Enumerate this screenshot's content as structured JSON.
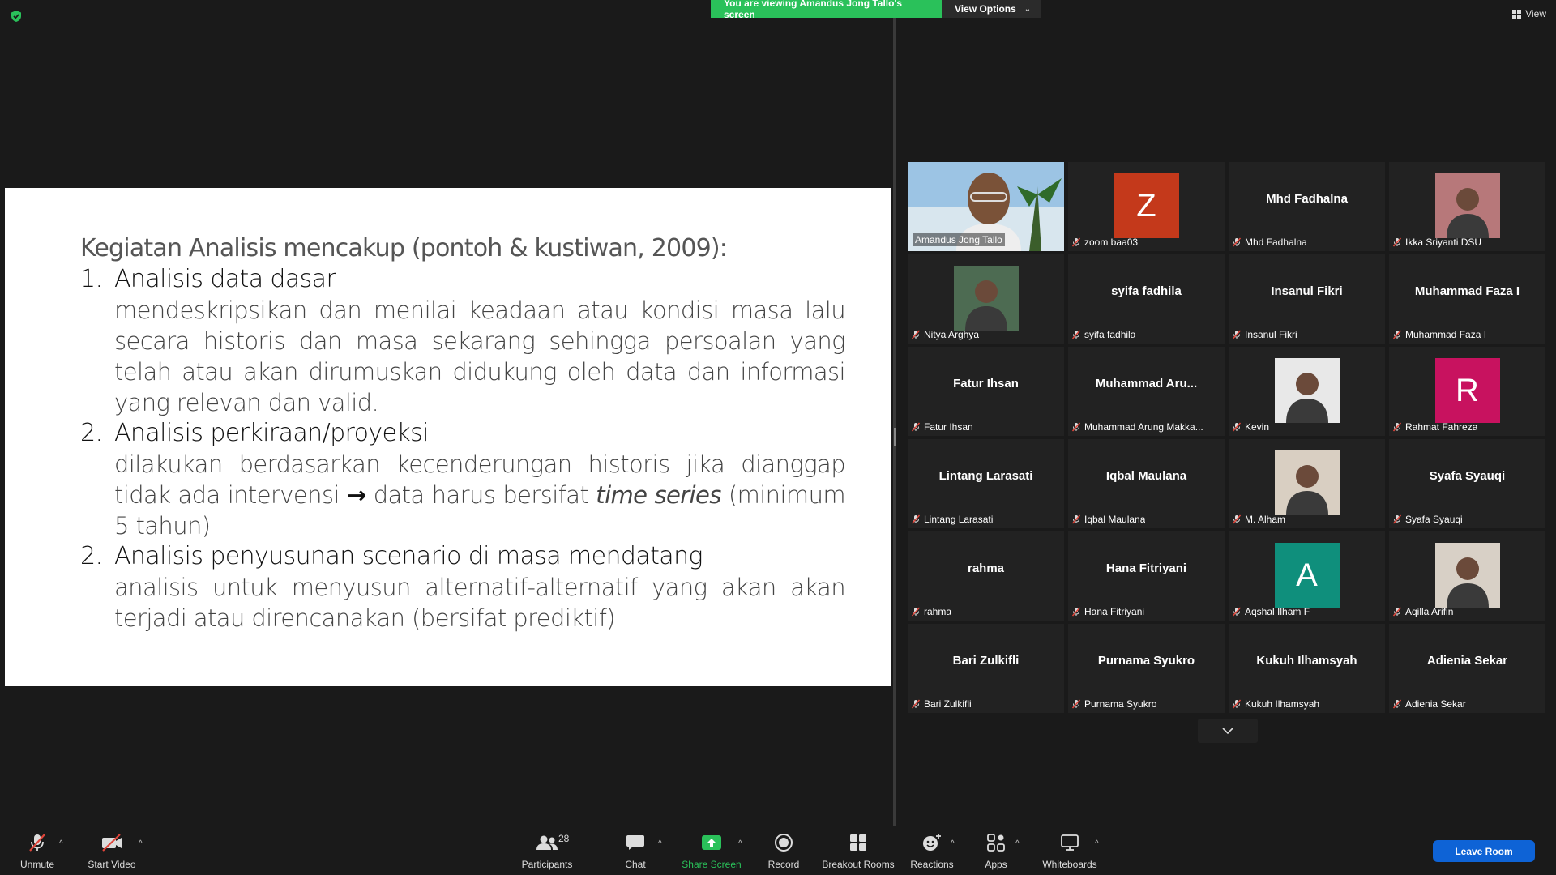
{
  "top": {
    "viewing_banner": "You are viewing Amandus Jong Tallo's screen",
    "view_options": "View Options",
    "view_button": "View"
  },
  "slide": {
    "heading": "Kegiatan Analisis mencakup (pontoh & kustiwan, 2009):",
    "items": [
      {
        "number": "1.",
        "title": "Analisis data dasar",
        "body": "mendeskripsikan dan menilai keadaan atau kondisi masa lalu secara historis dan masa sekarang sehingga persoalan yang telah atau akan  dirumuskan didukung oleh data dan informasi yang relevan dan valid."
      },
      {
        "number": "2.",
        "title": "Analisis perkiraan/proyeksi",
        "body_part1": "dilakukan berdasarkan kecenderungan historis jika dianggap tidak ada intervensi",
        "arrow": "→",
        "body_part2": "data harus bersifat",
        "body_italic": "time series",
        "body_part3": "(minimum 5 tahun)"
      },
      {
        "number": "2.",
        "title": "Analisis penyusunan scenario di masa mendatang",
        "body": "analisis untuk menyusun alternatif-alternatif yang akan akan terjadi atau direncanakan (bersifat prediktif)"
      }
    ]
  },
  "gallery": {
    "tiles": [
      {
        "label": "Amandus Jong Tallo",
        "display": "",
        "kind": "video",
        "active": true
      },
      {
        "label": "zoom baa03",
        "display": "Z",
        "kind": "avatar",
        "color": "#c4391b"
      },
      {
        "label": "Mhd Fadhalna",
        "display": "Mhd Fadhalna",
        "kind": "name"
      },
      {
        "label": "Ikka Sriyanti DSU",
        "display": "",
        "kind": "photo",
        "color": "#b7787a"
      },
      {
        "label": "Nitya Arghya",
        "display": "",
        "kind": "photo",
        "color": "#4d6b52"
      },
      {
        "label": "syifa fadhila",
        "display": "syifa fadhila",
        "kind": "name"
      },
      {
        "label": "Insanul Fikri",
        "display": "Insanul Fikri",
        "kind": "name"
      },
      {
        "label": "Muhammad Faza I",
        "display": "Muhammad Faza I",
        "kind": "name"
      },
      {
        "label": "Fatur Ihsan",
        "display": "Fatur Ihsan",
        "kind": "name"
      },
      {
        "label": "Muhammad Arung Makka...",
        "display": "Muhammad  Aru...",
        "kind": "name"
      },
      {
        "label": "Kevin",
        "display": "",
        "kind": "photo",
        "color": "#e8e8e8"
      },
      {
        "label": "Rahmat Fahreza",
        "display": "R",
        "kind": "avatar",
        "color": "#c8125f"
      },
      {
        "label": "Lintang Larasati",
        "display": "Lintang Larasati",
        "kind": "name"
      },
      {
        "label": "Iqbal Maulana",
        "display": "Iqbal Maulana",
        "kind": "name"
      },
      {
        "label": "M. Alham",
        "display": "",
        "kind": "photo",
        "color": "#d9cfc2"
      },
      {
        "label": "Syafa Syauqi",
        "display": "Syafa Syauqi",
        "kind": "name"
      },
      {
        "label": "rahma",
        "display": "rahma",
        "kind": "name"
      },
      {
        "label": "Hana Fitriyani",
        "display": "Hana Fitriyani",
        "kind": "name"
      },
      {
        "label": "Aqshal Ilham F",
        "display": "A",
        "kind": "avatar",
        "color": "#0f8f7c"
      },
      {
        "label": "Aqilla Arifin",
        "display": "",
        "kind": "photo",
        "color": "#d8d0c6"
      },
      {
        "label": "Bari Zulkifli",
        "display": "Bari Zulkifli",
        "kind": "name"
      },
      {
        "label": "Purnama Syukro",
        "display": "Purnama Syukro",
        "kind": "name"
      },
      {
        "label": "Kukuh Ilhamsyah",
        "display": "Kukuh Ilhamsyah",
        "kind": "name"
      },
      {
        "label": "Adienia Sekar",
        "display": "Adienia Sekar",
        "kind": "name"
      }
    ]
  },
  "toolbar": {
    "unmute": "Unmute",
    "start_video": "Start Video",
    "participants": "Participants",
    "participants_count": "28",
    "chat": "Chat",
    "share_screen": "Share Screen",
    "record": "Record",
    "breakout_rooms": "Breakout Rooms",
    "reactions": "Reactions",
    "apps": "Apps",
    "whiteboards": "Whiteboards",
    "leave_room": "Leave Room"
  },
  "colors": {
    "banner_green": "#2ac15a",
    "active_speaker": "#f4e94b",
    "leave_blue": "#0e63d6",
    "muted_red": "#e0453a"
  }
}
